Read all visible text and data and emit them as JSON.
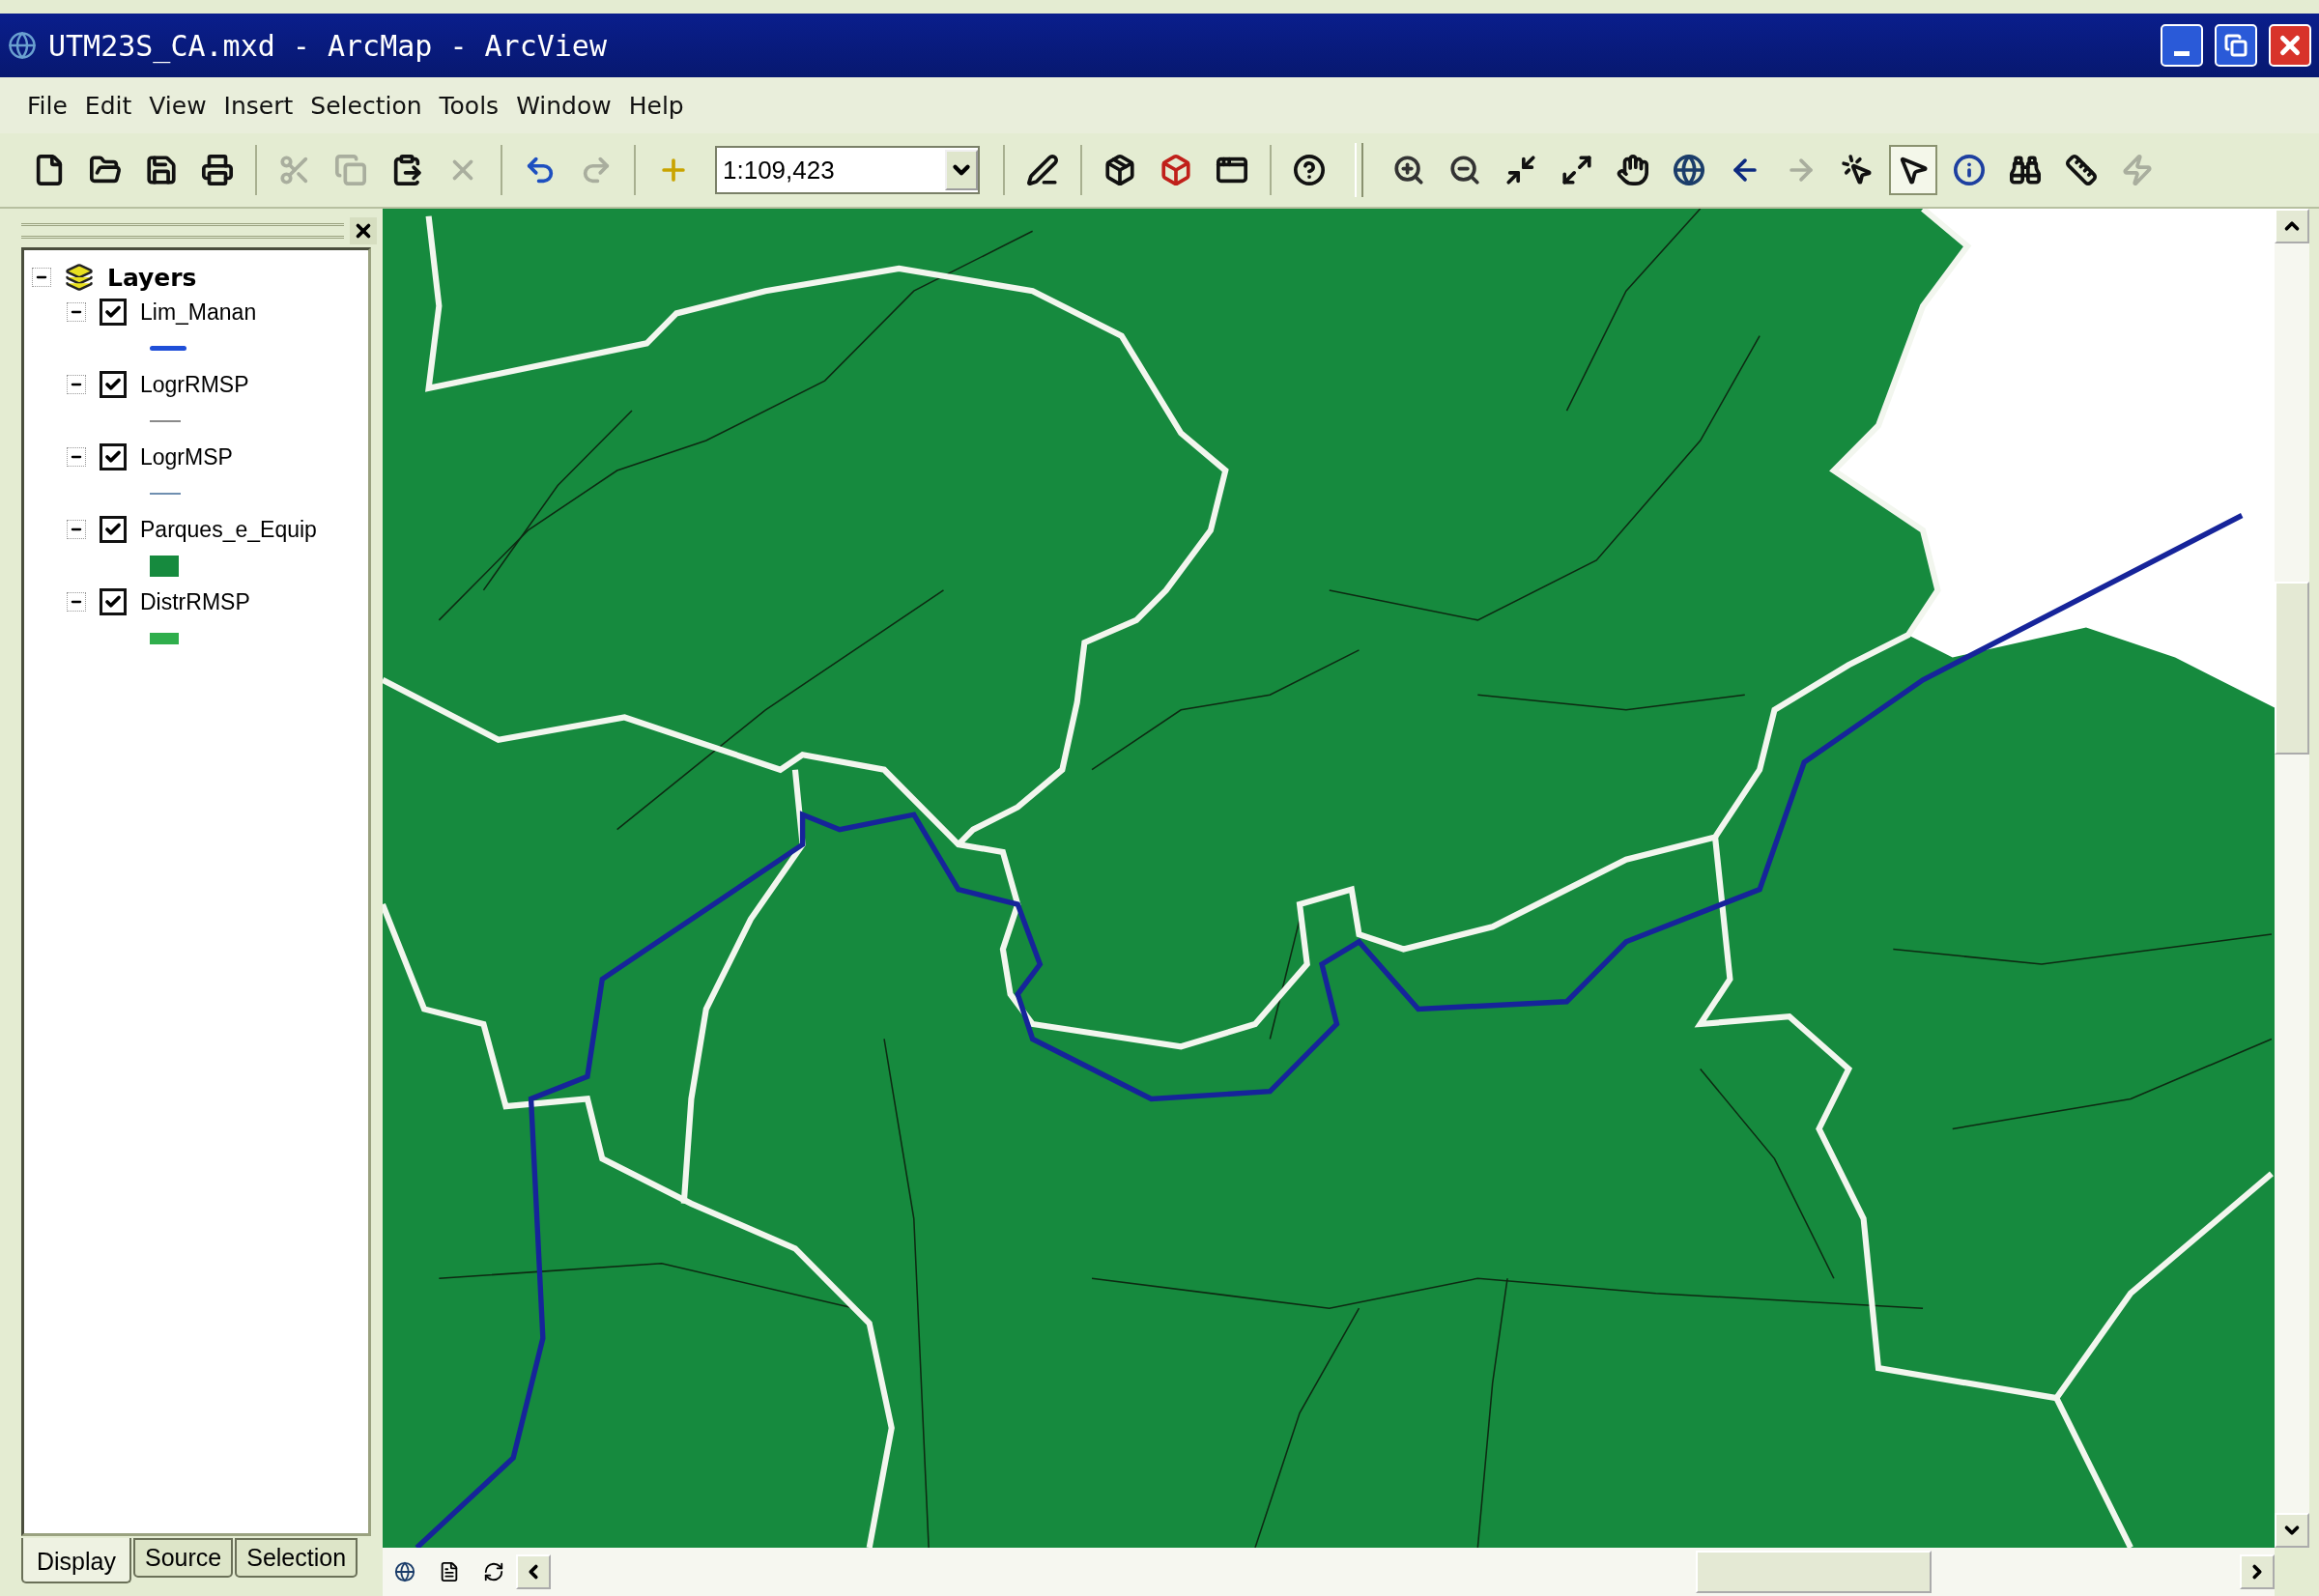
{
  "window": {
    "title": "UTM23S_CA.mxd - ArcMap - ArcView"
  },
  "menu": [
    {
      "label": "File"
    },
    {
      "label": "Edit"
    },
    {
      "label": "View"
    },
    {
      "label": "Insert"
    },
    {
      "label": "Selection"
    },
    {
      "label": "Tools"
    },
    {
      "label": "Window"
    },
    {
      "label": "Help"
    }
  ],
  "toolbar": {
    "left": [
      {
        "kind": "new",
        "disabled": false
      },
      {
        "kind": "open",
        "disabled": false
      },
      {
        "kind": "save",
        "disabled": false
      },
      {
        "kind": "print",
        "disabled": false
      },
      {
        "kind": "sep"
      },
      {
        "kind": "cut",
        "disabled": true
      },
      {
        "kind": "copy",
        "disabled": true
      },
      {
        "kind": "paste",
        "disabled": false
      },
      {
        "kind": "delete",
        "disabled": true
      },
      {
        "kind": "sep"
      },
      {
        "kind": "undo",
        "disabled": false
      },
      {
        "kind": "redo",
        "disabled": true
      },
      {
        "kind": "sep"
      },
      {
        "kind": "add",
        "disabled": false
      }
    ],
    "scale": "1:109,423",
    "right": [
      {
        "kind": "editor",
        "disabled": false
      },
      {
        "kind": "sep"
      },
      {
        "kind": "toolbox",
        "disabled": false
      },
      {
        "kind": "cube",
        "disabled": false
      },
      {
        "kind": "window",
        "disabled": false
      },
      {
        "kind": "sep"
      },
      {
        "kind": "help",
        "disabled": false
      },
      {
        "kind": "bar"
      },
      {
        "kind": "zoomin",
        "disabled": false,
        "selected": false
      },
      {
        "kind": "zoomout",
        "disabled": false,
        "selected": false
      },
      {
        "kind": "shrink",
        "disabled": false,
        "selected": false
      },
      {
        "kind": "expand",
        "disabled": false,
        "selected": false
      },
      {
        "kind": "pan",
        "disabled": false,
        "selected": false
      },
      {
        "kind": "globe",
        "disabled": false,
        "selected": false
      },
      {
        "kind": "back",
        "disabled": false,
        "selected": false
      },
      {
        "kind": "forward",
        "disabled": true,
        "selected": false
      },
      {
        "kind": "selectfeatures",
        "disabled": false,
        "selected": false
      },
      {
        "kind": "pointer",
        "disabled": false,
        "selected": true
      },
      {
        "kind": "info",
        "disabled": false,
        "selected": false
      },
      {
        "kind": "find",
        "disabled": false,
        "selected": false
      },
      {
        "kind": "measure",
        "disabled": false,
        "selected": false
      },
      {
        "kind": "hyperlink",
        "disabled": true,
        "selected": false
      }
    ]
  },
  "toc": {
    "label": "Layers",
    "expanded": true,
    "children": [
      {
        "label": "Lim_Manan",
        "checked": true,
        "expanded": true,
        "kind": "line",
        "color": "#1f4fd8"
      },
      {
        "label": "LogrRMSP",
        "checked": true,
        "expanded": true,
        "kind": "thin",
        "color": "#8a8a8a"
      },
      {
        "label": "LogrMSP",
        "checked": true,
        "expanded": true,
        "kind": "thin",
        "color": "#6f8fb0"
      },
      {
        "label": "Parques_e_Equip",
        "checked": true,
        "expanded": true,
        "kind": "fill",
        "color": "#168a3e"
      },
      {
        "label": "DistrRMSP",
        "checked": true,
        "expanded": true,
        "kind": "fill",
        "color": "#2fae4c"
      }
    ]
  },
  "tabs": [
    {
      "label": "Display",
      "selected": true
    },
    {
      "label": "Source",
      "selected": false
    },
    {
      "label": "Selection",
      "selected": false
    }
  ]
}
